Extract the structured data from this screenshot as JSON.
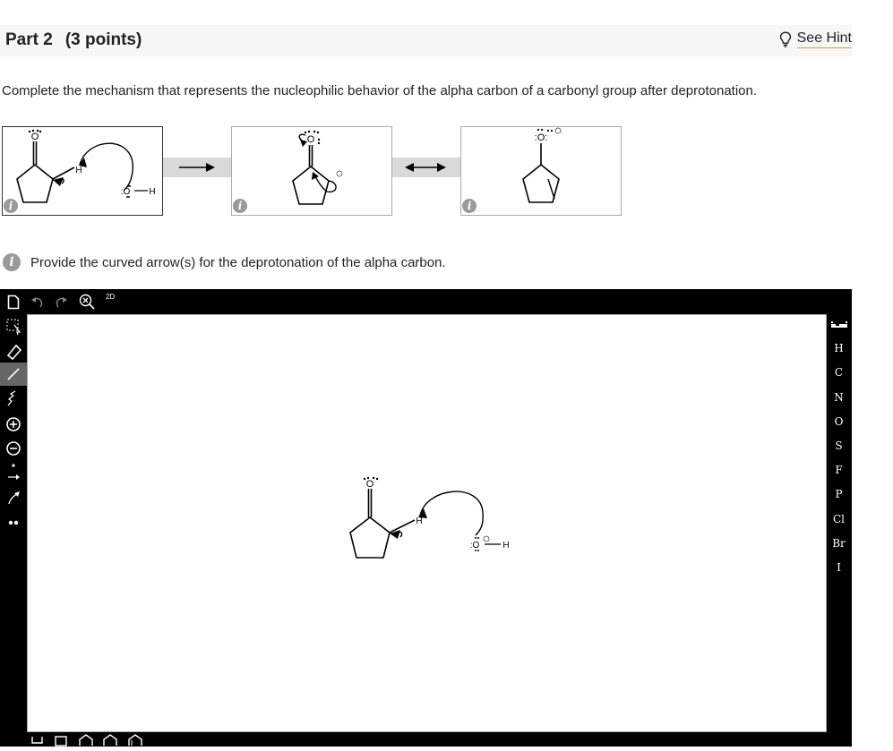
{
  "header": {
    "part": "Part 2",
    "points": "(3 points)",
    "hint_label": "See Hint"
  },
  "prompt": "Complete the mechanism that represents the nucleophilic behavior of the alpha carbon of a carbonyl group after deprotonation.",
  "mechanism": {
    "box1": {
      "lone_o": "O",
      "h": "H",
      "base_o": ":O",
      "base_h": "H"
    },
    "box2": {
      "o": "O"
    },
    "box3": {
      "o": ":O:"
    },
    "info_glyph": "i"
  },
  "sub_prompt": "Provide the curved arrow(s) for the deprotonation of the alpha carbon.",
  "editor": {
    "top_badge": "2D",
    "elements": [
      "H",
      "C",
      "N",
      "O",
      "S",
      "F",
      "P",
      "Cl",
      "Br",
      "I"
    ],
    "canvas_labels": {
      "o": "O",
      "h": "H",
      "base_o": ":O",
      "base_h": "H"
    }
  }
}
